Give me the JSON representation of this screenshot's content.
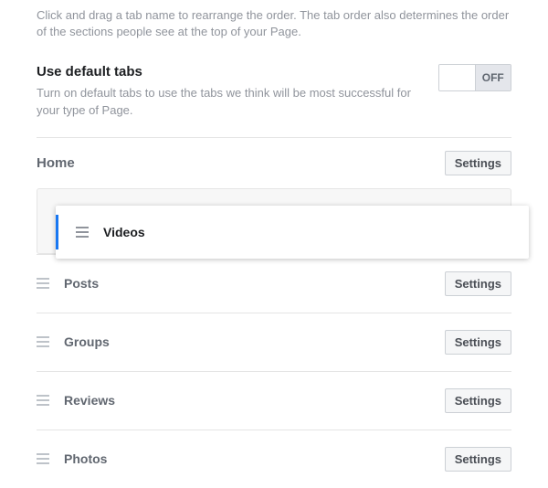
{
  "intro": "Click and drag a tab name to rearrange the order. The tab order also determines the order of the sections people see at the top of your Page.",
  "default_tabs": {
    "title": "Use default tabs",
    "desc": "Turn on default tabs to use the tabs we think will be most successful for your type of Page.",
    "toggle_label": "OFF"
  },
  "home": {
    "label": "Home",
    "settings_label": "Settings"
  },
  "dragging": {
    "label": "Videos"
  },
  "tabs": [
    {
      "label": "Posts",
      "settings_label": "Settings"
    },
    {
      "label": "Groups",
      "settings_label": "Settings"
    },
    {
      "label": "Reviews",
      "settings_label": "Settings"
    },
    {
      "label": "Photos",
      "settings_label": "Settings"
    }
  ]
}
